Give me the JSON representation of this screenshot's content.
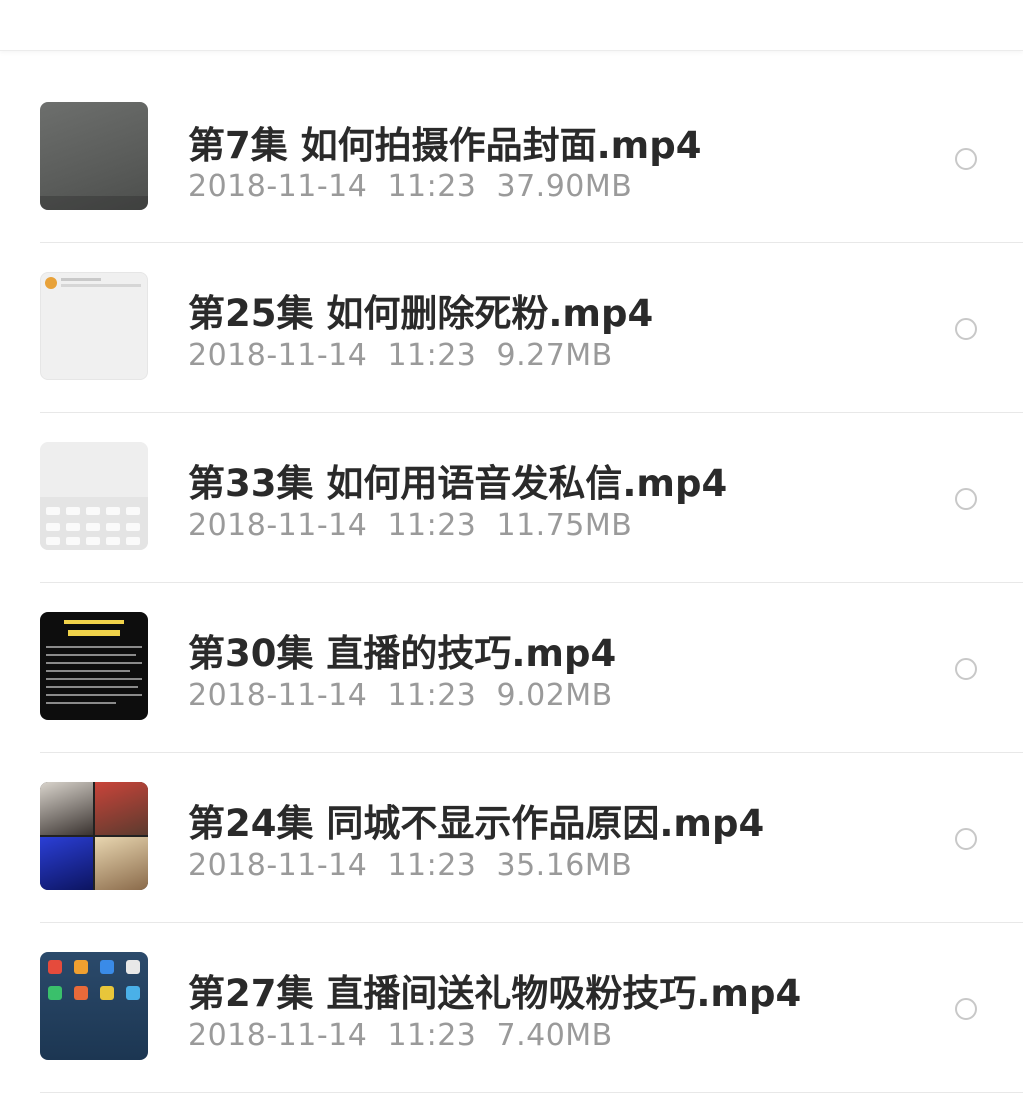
{
  "files": [
    {
      "title": "第7集 如何拍摄作品封面.mp4",
      "date": "2018-11-14",
      "time": "11:23",
      "size": "37.90MB",
      "thumb": "gray-video-frame"
    },
    {
      "title": "第25集 如何删除死粉.mp4",
      "date": "2018-11-14",
      "time": "11:23",
      "size": "9.27MB",
      "thumb": "light-chat-screen"
    },
    {
      "title": "第33集 如何用语音发私信.mp4",
      "date": "2018-11-14",
      "time": "11:23",
      "size": "11.75MB",
      "thumb": "keyboard-screen"
    },
    {
      "title": "第30集 直播的技巧.mp4",
      "date": "2018-11-14",
      "time": "11:23",
      "size": "9.02MB",
      "thumb": "dark-text-slide"
    },
    {
      "title": "第24集 同城不显示作品原因.mp4",
      "date": "2018-11-14",
      "time": "11:23",
      "size": "35.16MB",
      "thumb": "photo-collage"
    },
    {
      "title": "第27集 直播间送礼物吸粉技巧.mp4",
      "date": "2018-11-14",
      "time": "11:23",
      "size": "7.40MB",
      "thumb": "phone-homescreen"
    }
  ],
  "colors": {
    "title": "#2a2a2a",
    "meta": "#9a9a9a",
    "divider": "#e8e8e8",
    "radio_border": "#c8c8c8"
  }
}
